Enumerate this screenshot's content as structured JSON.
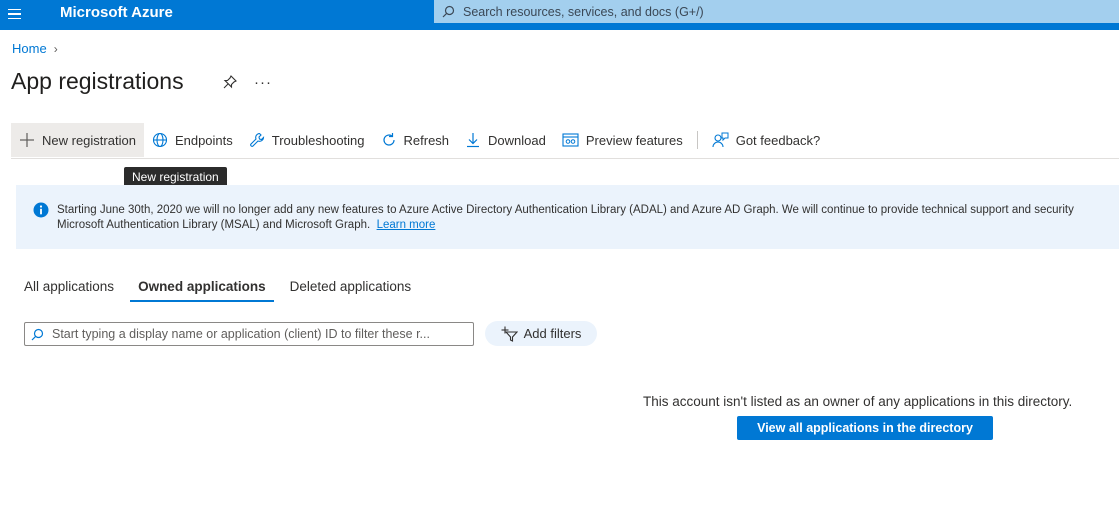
{
  "topbar": {
    "brand": "Microsoft Azure",
    "search_placeholder": "Search resources, services, and docs (G+/)"
  },
  "breadcrumb": {
    "home": "Home"
  },
  "page": {
    "title": "App registrations"
  },
  "toolbar": {
    "new_registration": "New registration",
    "endpoints": "Endpoints",
    "troubleshooting": "Troubleshooting",
    "refresh": "Refresh",
    "download": "Download",
    "preview_features": "Preview features",
    "got_feedback": "Got feedback?"
  },
  "tooltip": {
    "text": "New registration"
  },
  "banner": {
    "line1": "Starting June 30th, 2020 we will no longer add any new features to Azure Active Directory Authentication Library (ADAL) and Azure AD Graph. We will continue to provide technical support and security",
    "line2": "Microsoft Authentication Library (MSAL) and Microsoft Graph.",
    "link": "Learn more"
  },
  "tabs": [
    {
      "label": "All applications"
    },
    {
      "label": "Owned applications"
    },
    {
      "label": "Deleted applications"
    }
  ],
  "filter": {
    "placeholder": "Start typing a display name or application (client) ID to filter these r...",
    "add_filters": "Add filters"
  },
  "empty_state": {
    "message": "This account isn't listed as an owner of any applications in this directory.",
    "button": "View all applications in the directory"
  },
  "colors": {
    "accent": "#0078d4",
    "banner_bg": "#ebf3fc"
  }
}
